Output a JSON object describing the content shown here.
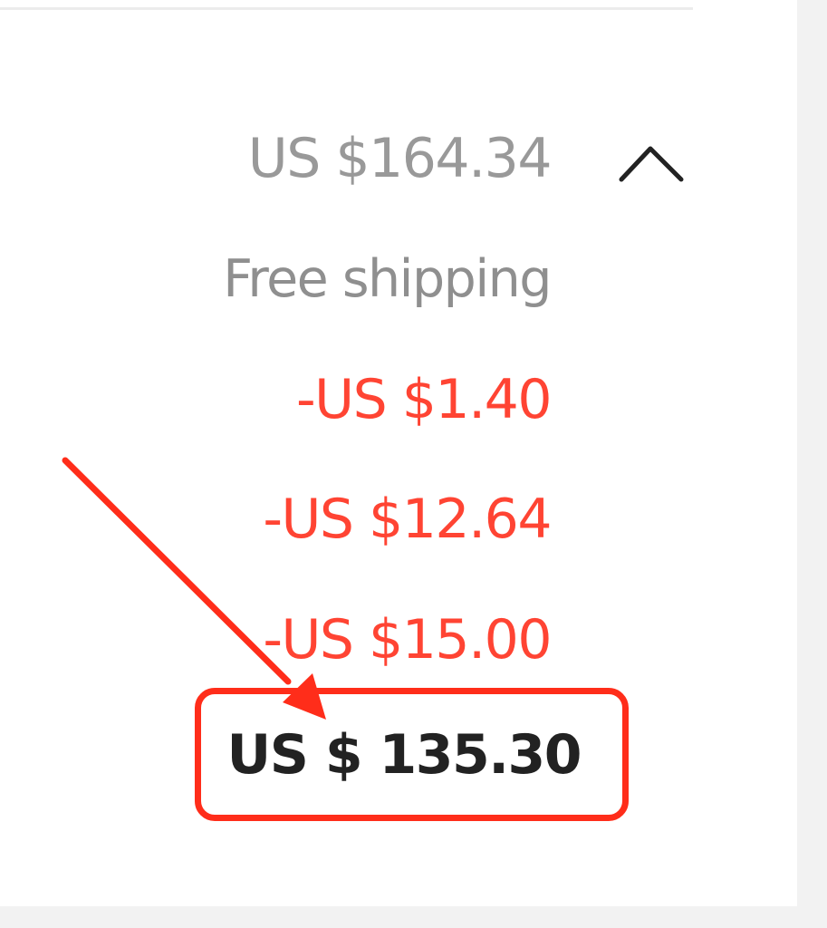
{
  "order_summary": {
    "subtotal": "US $164.34",
    "shipping": "Free shipping",
    "discounts": [
      "-US $1.40",
      "-US $12.64",
      "-US $15.00"
    ],
    "total": "US $ 135.30",
    "collapse_icon": "chevron-up-icon"
  },
  "colors": {
    "discount": "#ff4433",
    "highlight": "#ff2d1a",
    "total_text": "#222222",
    "muted_text": "#999999"
  }
}
